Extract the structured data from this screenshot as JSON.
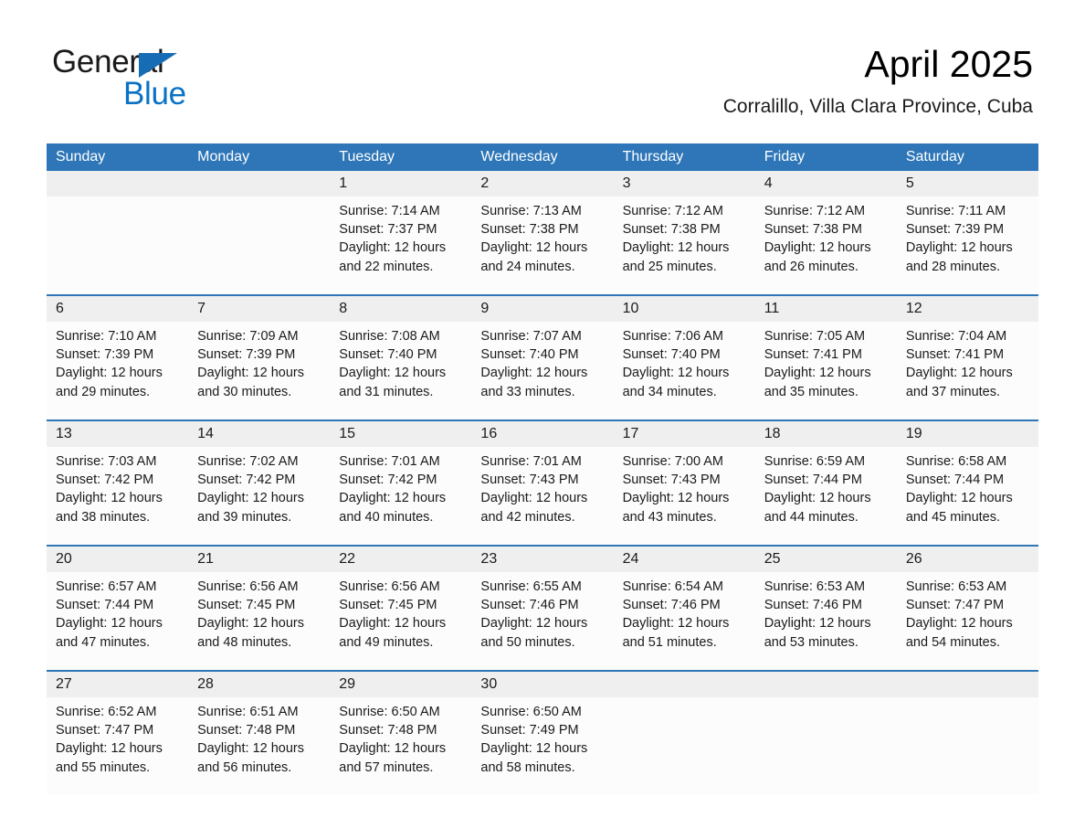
{
  "brand": {
    "word_one": "General",
    "word_two": "Blue",
    "triangle_color": "#176db5",
    "blue_text_color": "#0a72c4"
  },
  "header": {
    "title": "April 2025",
    "subtitle": "Corralillo, Villa Clara Province, Cuba"
  },
  "theme": {
    "header_blue": "#2e76b8",
    "daynum_band": "#efefef",
    "cell_background": "#fcfcfc",
    "separator_blue": "#2e76b8"
  },
  "weekdays": [
    "Sunday",
    "Monday",
    "Tuesday",
    "Wednesday",
    "Thursday",
    "Friday",
    "Saturday"
  ],
  "weeks": [
    [
      {
        "day": "",
        "lines": []
      },
      {
        "day": "",
        "lines": []
      },
      {
        "day": "1",
        "lines": [
          "Sunrise: 7:14 AM",
          "Sunset: 7:37 PM",
          "Daylight: 12 hours",
          "and 22 minutes."
        ]
      },
      {
        "day": "2",
        "lines": [
          "Sunrise: 7:13 AM",
          "Sunset: 7:38 PM",
          "Daylight: 12 hours",
          "and 24 minutes."
        ]
      },
      {
        "day": "3",
        "lines": [
          "Sunrise: 7:12 AM",
          "Sunset: 7:38 PM",
          "Daylight: 12 hours",
          "and 25 minutes."
        ]
      },
      {
        "day": "4",
        "lines": [
          "Sunrise: 7:12 AM",
          "Sunset: 7:38 PM",
          "Daylight: 12 hours",
          "and 26 minutes."
        ]
      },
      {
        "day": "5",
        "lines": [
          "Sunrise: 7:11 AM",
          "Sunset: 7:39 PM",
          "Daylight: 12 hours",
          "and 28 minutes."
        ]
      }
    ],
    [
      {
        "day": "6",
        "lines": [
          "Sunrise: 7:10 AM",
          "Sunset: 7:39 PM",
          "Daylight: 12 hours",
          "and 29 minutes."
        ]
      },
      {
        "day": "7",
        "lines": [
          "Sunrise: 7:09 AM",
          "Sunset: 7:39 PM",
          "Daylight: 12 hours",
          "and 30 minutes."
        ]
      },
      {
        "day": "8",
        "lines": [
          "Sunrise: 7:08 AM",
          "Sunset: 7:40 PM",
          "Daylight: 12 hours",
          "and 31 minutes."
        ]
      },
      {
        "day": "9",
        "lines": [
          "Sunrise: 7:07 AM",
          "Sunset: 7:40 PM",
          "Daylight: 12 hours",
          "and 33 minutes."
        ]
      },
      {
        "day": "10",
        "lines": [
          "Sunrise: 7:06 AM",
          "Sunset: 7:40 PM",
          "Daylight: 12 hours",
          "and 34 minutes."
        ]
      },
      {
        "day": "11",
        "lines": [
          "Sunrise: 7:05 AM",
          "Sunset: 7:41 PM",
          "Daylight: 12 hours",
          "and 35 minutes."
        ]
      },
      {
        "day": "12",
        "lines": [
          "Sunrise: 7:04 AM",
          "Sunset: 7:41 PM",
          "Daylight: 12 hours",
          "and 37 minutes."
        ]
      }
    ],
    [
      {
        "day": "13",
        "lines": [
          "Sunrise: 7:03 AM",
          "Sunset: 7:42 PM",
          "Daylight: 12 hours",
          "and 38 minutes."
        ]
      },
      {
        "day": "14",
        "lines": [
          "Sunrise: 7:02 AM",
          "Sunset: 7:42 PM",
          "Daylight: 12 hours",
          "and 39 minutes."
        ]
      },
      {
        "day": "15",
        "lines": [
          "Sunrise: 7:01 AM",
          "Sunset: 7:42 PM",
          "Daylight: 12 hours",
          "and 40 minutes."
        ]
      },
      {
        "day": "16",
        "lines": [
          "Sunrise: 7:01 AM",
          "Sunset: 7:43 PM",
          "Daylight: 12 hours",
          "and 42 minutes."
        ]
      },
      {
        "day": "17",
        "lines": [
          "Sunrise: 7:00 AM",
          "Sunset: 7:43 PM",
          "Daylight: 12 hours",
          "and 43 minutes."
        ]
      },
      {
        "day": "18",
        "lines": [
          "Sunrise: 6:59 AM",
          "Sunset: 7:44 PM",
          "Daylight: 12 hours",
          "and 44 minutes."
        ]
      },
      {
        "day": "19",
        "lines": [
          "Sunrise: 6:58 AM",
          "Sunset: 7:44 PM",
          "Daylight: 12 hours",
          "and 45 minutes."
        ]
      }
    ],
    [
      {
        "day": "20",
        "lines": [
          "Sunrise: 6:57 AM",
          "Sunset: 7:44 PM",
          "Daylight: 12 hours",
          "and 47 minutes."
        ]
      },
      {
        "day": "21",
        "lines": [
          "Sunrise: 6:56 AM",
          "Sunset: 7:45 PM",
          "Daylight: 12 hours",
          "and 48 minutes."
        ]
      },
      {
        "day": "22",
        "lines": [
          "Sunrise: 6:56 AM",
          "Sunset: 7:45 PM",
          "Daylight: 12 hours",
          "and 49 minutes."
        ]
      },
      {
        "day": "23",
        "lines": [
          "Sunrise: 6:55 AM",
          "Sunset: 7:46 PM",
          "Daylight: 12 hours",
          "and 50 minutes."
        ]
      },
      {
        "day": "24",
        "lines": [
          "Sunrise: 6:54 AM",
          "Sunset: 7:46 PM",
          "Daylight: 12 hours",
          "and 51 minutes."
        ]
      },
      {
        "day": "25",
        "lines": [
          "Sunrise: 6:53 AM",
          "Sunset: 7:46 PM",
          "Daylight: 12 hours",
          "and 53 minutes."
        ]
      },
      {
        "day": "26",
        "lines": [
          "Sunrise: 6:53 AM",
          "Sunset: 7:47 PM",
          "Daylight: 12 hours",
          "and 54 minutes."
        ]
      }
    ],
    [
      {
        "day": "27",
        "lines": [
          "Sunrise: 6:52 AM",
          "Sunset: 7:47 PM",
          "Daylight: 12 hours",
          "and 55 minutes."
        ]
      },
      {
        "day": "28",
        "lines": [
          "Sunrise: 6:51 AM",
          "Sunset: 7:48 PM",
          "Daylight: 12 hours",
          "and 56 minutes."
        ]
      },
      {
        "day": "29",
        "lines": [
          "Sunrise: 6:50 AM",
          "Sunset: 7:48 PM",
          "Daylight: 12 hours",
          "and 57 minutes."
        ]
      },
      {
        "day": "30",
        "lines": [
          "Sunrise: 6:50 AM",
          "Sunset: 7:49 PM",
          "Daylight: 12 hours",
          "and 58 minutes."
        ]
      },
      {
        "day": "",
        "lines": []
      },
      {
        "day": "",
        "lines": []
      },
      {
        "day": "",
        "lines": []
      }
    ]
  ]
}
